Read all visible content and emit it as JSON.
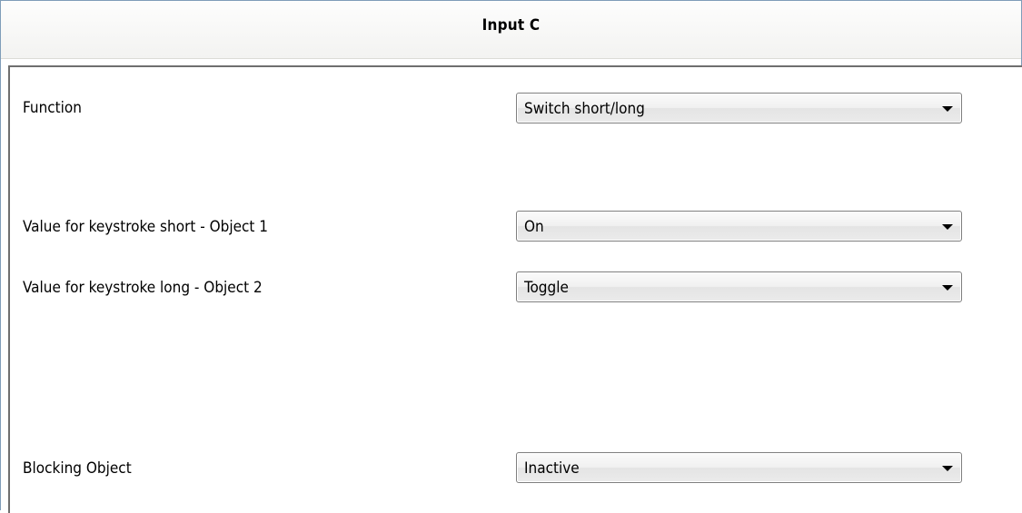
{
  "header": {
    "title": "Input C"
  },
  "params": [
    {
      "label": "Function",
      "value": "Switch short/long"
    },
    {
      "label": "Value for keystroke short - Object 1",
      "value": "On"
    },
    {
      "label": "Value for keystroke long - Object 2",
      "value": "Toggle"
    },
    {
      "label": "Blocking Object",
      "value": "Inactive"
    }
  ],
  "icons": {
    "dropdown": "chevron-down-icon"
  },
  "colors": {
    "border": "#7f9db9",
    "panel_edge": "#6f6f6f"
  }
}
